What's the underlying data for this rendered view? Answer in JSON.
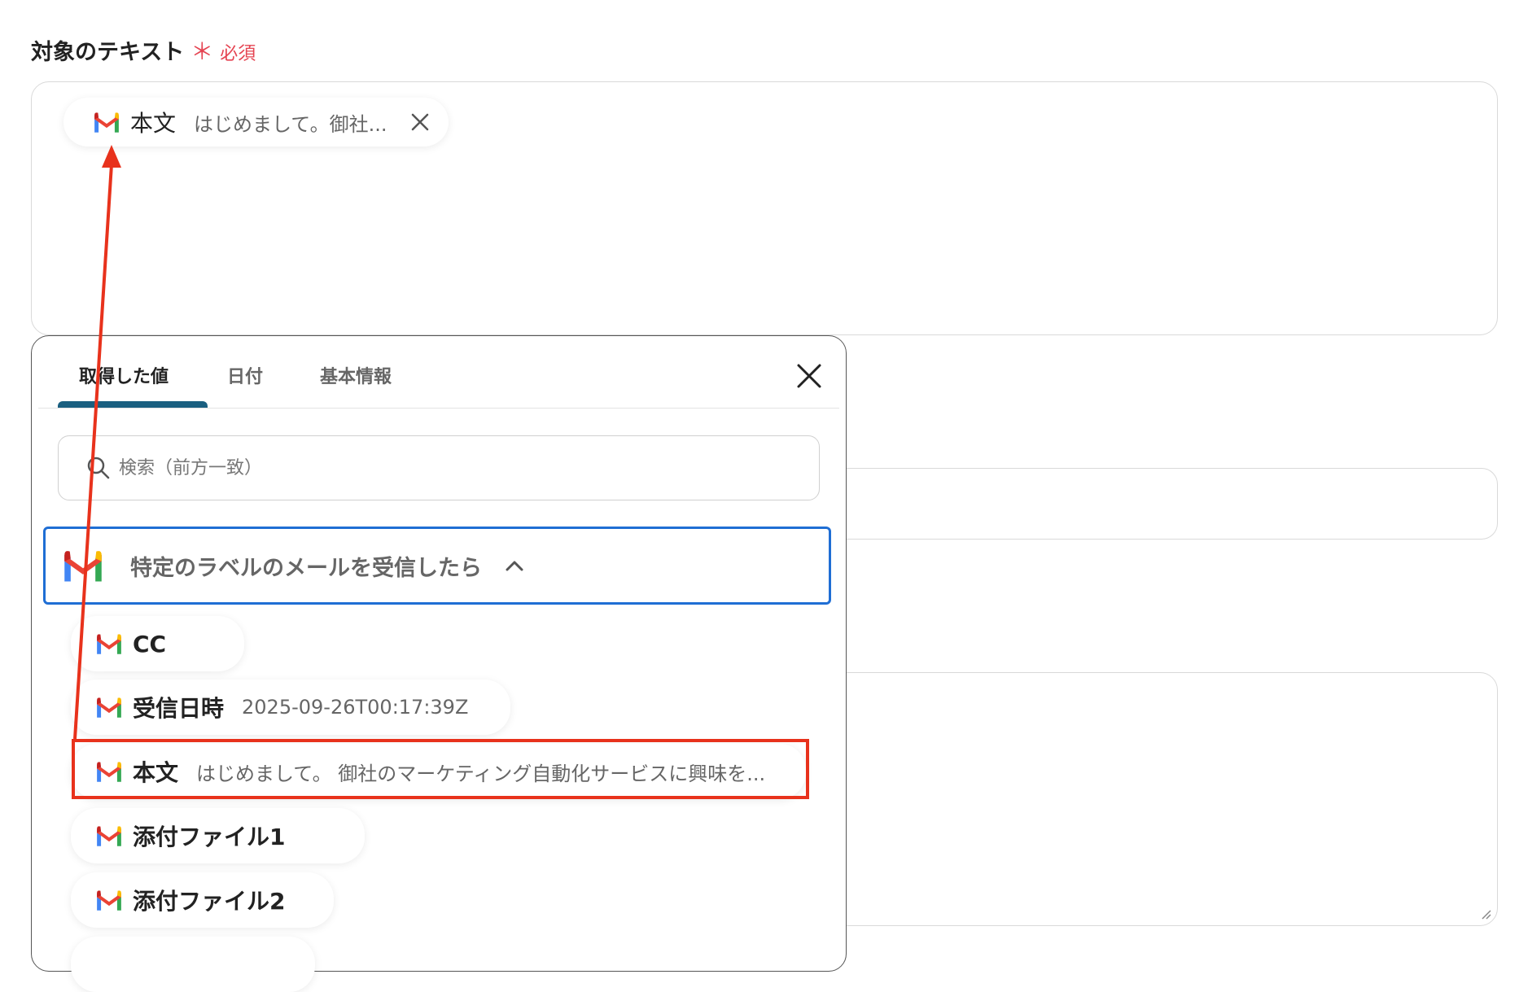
{
  "field": {
    "label": "対象のテキスト",
    "required_star": "＊",
    "required_text": "必須"
  },
  "selected_chip": {
    "icon": "gmail-icon",
    "key": "本文",
    "value": "はじめまして。御社..."
  },
  "panel": {
    "tabs": [
      {
        "label": "取得した値",
        "active": true
      },
      {
        "label": "日付",
        "active": false
      },
      {
        "label": "基本情報",
        "active": false
      }
    ],
    "search_placeholder": "検索（前方一致）",
    "group": {
      "icon": "gmail-icon",
      "title": "特定のラベルのメールを受信したら",
      "expanded": true
    },
    "items": [
      {
        "icon": "gmail-icon",
        "key": "CC",
        "value": ""
      },
      {
        "icon": "gmail-icon",
        "key": "受信日時",
        "value": "2025-09-26T00:17:39Z"
      },
      {
        "icon": "gmail-icon",
        "key": "本文",
        "value": "はじめまして。 御社のマーケティング自動化サービスに興味を...",
        "highlighted": true
      },
      {
        "icon": "gmail-icon",
        "key": "添付ファイル1",
        "value": ""
      },
      {
        "icon": "gmail-icon",
        "key": "添付ファイル2",
        "value": ""
      }
    ]
  },
  "colors": {
    "required": "#e54452",
    "tab_underline": "#1a5f80",
    "group_border": "#1f6ed4",
    "annotation": "#e8321c"
  }
}
